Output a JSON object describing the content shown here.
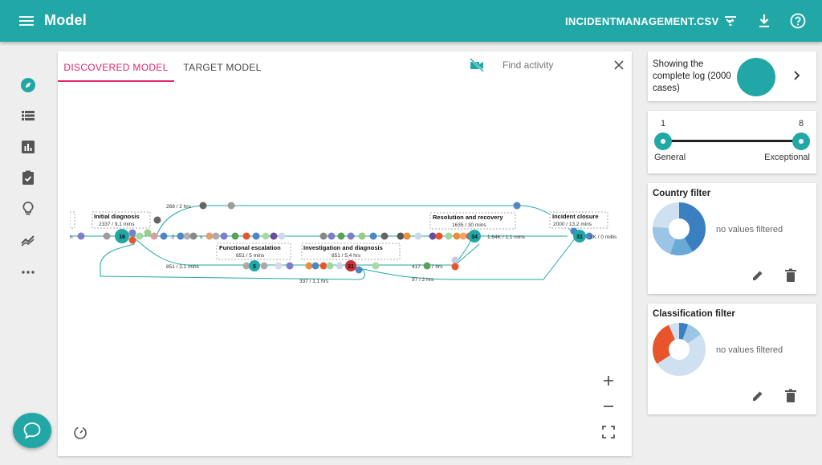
{
  "topbar": {
    "title": "Model",
    "file_name": "INCIDENTMANAGEMENT.CSV",
    "icons": [
      "menu-icon",
      "chevron-down-icon",
      "filter-icon",
      "download-icon",
      "help-icon"
    ]
  },
  "rail": {
    "icons": [
      "compass-icon",
      "list-icon",
      "bar-chart-icon",
      "clipboard-check-icon",
      "lightbulb-icon",
      "trending-icon",
      "more-icon"
    ]
  },
  "main": {
    "tabs": [
      {
        "label": "DISCOVERED MODEL",
        "active": true
      },
      {
        "label": "TARGET MODEL",
        "active": false
      }
    ],
    "find_placeholder": "Find activity",
    "graph": {
      "activities": [
        {
          "name": "Initial diagnosis",
          "stats": "2337 / 9,1 mins",
          "count": "16"
        },
        {
          "name": "Functional escalation",
          "stats": "851 / 5 mins",
          "count": "5"
        },
        {
          "name": "Investigation and diagnosis",
          "stats": "851 / 5,4 hrs",
          "count": "21"
        },
        {
          "name": "Resolution and recovery",
          "stats": "1635 / 30 mins",
          "count": "34"
        },
        {
          "name": "Incident closure",
          "stats": "2000 / 13,2 mins",
          "count": "31"
        }
      ],
      "edge_labels": {
        "top": "268 / 2 hrs",
        "mid_left": "851 / 2,1 mins",
        "mid_right": "417",
        "mid_right_unit": "7 hrs",
        "bottom": "337 / 1,1 hrs",
        "lower_right": "97 / 2 hrs",
        "main_right": "1.64K / 1,1 mins",
        "end": "2K / 0 millis",
        "left_start": "n",
        "left_mid": ".2",
        "left_mid2": "s"
      }
    },
    "zoom_icons": [
      "plus-icon",
      "minus-icon",
      "fullscreen-icon",
      "speed-icon",
      "camera-off-icon",
      "close-icon"
    ]
  },
  "log_card": {
    "text": "Showing the complete log (2000 cases)"
  },
  "slider": {
    "min": "1",
    "max": "8",
    "label_left": "General",
    "label_right": "Exceptional"
  },
  "country_filter": {
    "title": "Country filter",
    "status": "no values filtered"
  },
  "classification_filter": {
    "title": "Classification filter",
    "status": "no values filtered"
  },
  "colors": {
    "primary": "#21a8a6",
    "tab_active": "#e2266b"
  }
}
